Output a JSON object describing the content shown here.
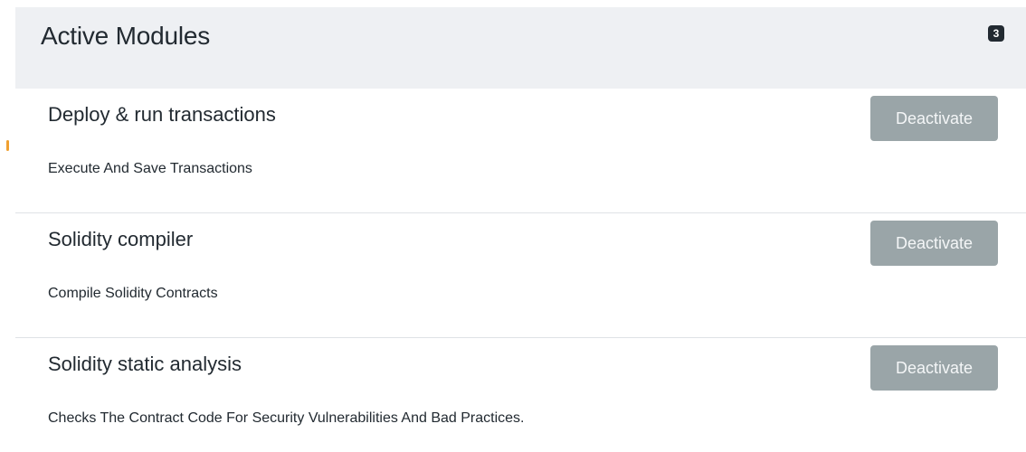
{
  "header": {
    "title": "Active Modules",
    "count": "3"
  },
  "modules": [
    {
      "name": "Deploy & run transactions",
      "description": "Execute And Save Transactions",
      "button_label": "Deactivate"
    },
    {
      "name": "Solidity compiler",
      "description": "Compile Solidity Contracts",
      "button_label": "Deactivate"
    },
    {
      "name": "Solidity static analysis",
      "description": "Checks The Contract Code For Security Vulnerabilities And Bad Practices.",
      "button_label": "Deactivate"
    }
  ],
  "colors": {
    "header_bg": "#eef0f3",
    "button_bg": "#9aa5a8",
    "text": "#222a31",
    "badge_bg": "#222a31",
    "indicator": "#f0a030"
  }
}
